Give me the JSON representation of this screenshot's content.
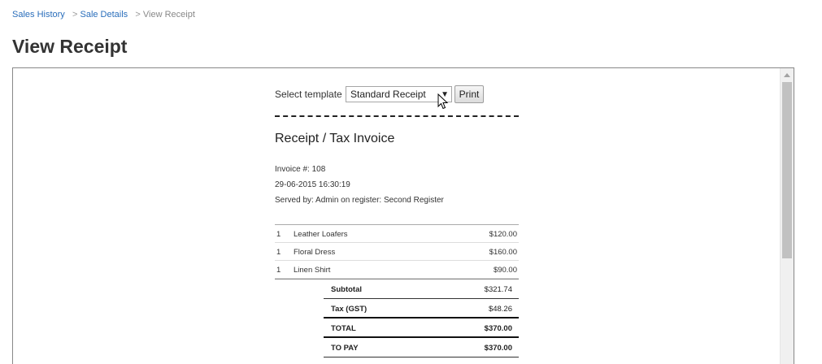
{
  "breadcrumb": {
    "items": [
      {
        "label": "Sales History"
      },
      {
        "label": "Sale Details"
      }
    ],
    "separator": ">",
    "current": "View Receipt"
  },
  "page_title": "View Receipt",
  "receipt_view": {
    "template_label": "Select template",
    "template_selected": "Standard Receipt",
    "print_label": "Print",
    "title": "Receipt / Tax Invoice",
    "invoice_line": "Invoice #: 108",
    "datetime": "29-06-2015 16:30:19",
    "served_line": "Served by: Admin on register: Second Register",
    "items": [
      {
        "qty": "1",
        "name": "Leather Loafers",
        "price": "$120.00"
      },
      {
        "qty": "1",
        "name": "Floral Dress",
        "price": "$160.00"
      },
      {
        "qty": "1",
        "name": "Linen Shirt",
        "price": "$90.00"
      }
    ],
    "totals": [
      {
        "label": "Subtotal",
        "value": "$321.74"
      },
      {
        "label": "Tax (GST)",
        "value": "$48.26"
      },
      {
        "label": "TOTAL",
        "value": "$370.00"
      },
      {
        "label": "TO PAY",
        "value": "$370.00"
      }
    ]
  },
  "icons": {
    "select_arrow": "dropdown-arrow-icon",
    "cursor": "mouse-pointer-icon",
    "scroll_up": "scroll-up-arrow-icon"
  },
  "colors": {
    "link": "#2a6ebb",
    "text": "#333333",
    "frame_border": "#888888"
  }
}
